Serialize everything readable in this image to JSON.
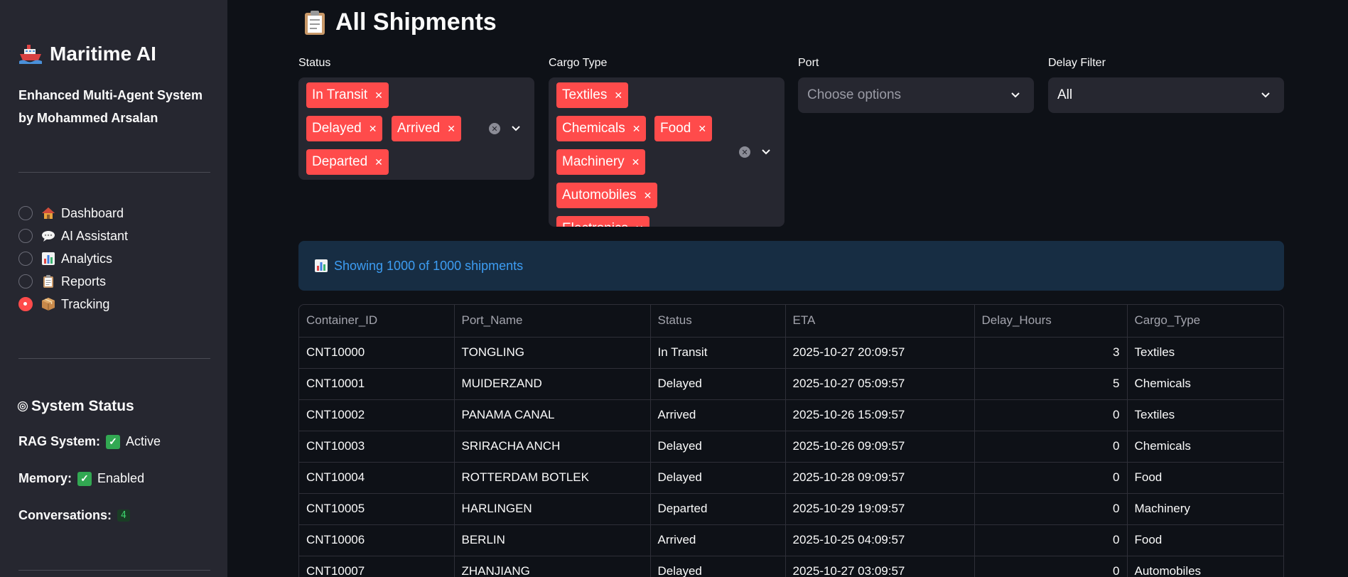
{
  "sidebar": {
    "title": "Maritime AI",
    "subtitle": "Enhanced Multi-Agent System by Mohammed Arsalan",
    "nav": [
      {
        "label": "Dashboard",
        "icon": "house-icon",
        "selected": false
      },
      {
        "label": "AI Assistant",
        "icon": "speech-bubble-icon",
        "selected": false
      },
      {
        "label": "Analytics",
        "icon": "bar-chart-icon",
        "selected": false
      },
      {
        "label": "Reports",
        "icon": "clipboard-icon",
        "selected": false
      },
      {
        "label": "Tracking",
        "icon": "package-icon",
        "selected": true
      }
    ],
    "system_status": {
      "title": "System Status",
      "rag_label": "RAG System:",
      "rag_value": "Active",
      "memory_label": "Memory:",
      "memory_value": "Enabled",
      "conversations_label": "Conversations:",
      "conversations_value": "4"
    }
  },
  "main": {
    "title": "All Shipments",
    "filters": {
      "status": {
        "label": "Status",
        "selected": [
          "In Transit",
          "Delayed",
          "Arrived",
          "Departed"
        ]
      },
      "cargo_type": {
        "label": "Cargo Type",
        "selected": [
          "Textiles",
          "Chemicals",
          "Food",
          "Machinery",
          "Automobiles",
          "Electronics"
        ]
      },
      "port": {
        "label": "Port",
        "placeholder": "Choose options"
      },
      "delay": {
        "label": "Delay Filter",
        "value": "All"
      }
    },
    "info": "Showing 1000 of 1000 shipments",
    "table": {
      "columns": [
        "Container_ID",
        "Port_Name",
        "Status",
        "ETA",
        "Delay_Hours",
        "Cargo_Type"
      ],
      "rows": [
        [
          "CNT10000",
          "TONGLING",
          "In Transit",
          "2025-10-27 20:09:57",
          "3",
          "Textiles"
        ],
        [
          "CNT10001",
          "MUIDERZAND",
          "Delayed",
          "2025-10-27 05:09:57",
          "5",
          "Chemicals"
        ],
        [
          "CNT10002",
          "PANAMA CANAL",
          "Arrived",
          "2025-10-26 15:09:57",
          "0",
          "Textiles"
        ],
        [
          "CNT10003",
          "SRIRACHA ANCH",
          "Delayed",
          "2025-10-26 09:09:57",
          "0",
          "Chemicals"
        ],
        [
          "CNT10004",
          "ROTTERDAM BOTLEK",
          "Delayed",
          "2025-10-28 09:09:57",
          "0",
          "Food"
        ],
        [
          "CNT10005",
          "HARLINGEN",
          "Departed",
          "2025-10-29 19:09:57",
          "0",
          "Machinery"
        ],
        [
          "CNT10006",
          "BERLIN",
          "Arrived",
          "2025-10-25 04:09:57",
          "0",
          "Food"
        ],
        [
          "CNT10007",
          "ZHANJIANG",
          "Delayed",
          "2025-10-27 03:09:57",
          "0",
          "Automobiles"
        ]
      ]
    }
  },
  "colors": {
    "accent": "#ff4b4b",
    "sidebar_bg": "#262730",
    "page_bg": "#0e1117",
    "info_bg": "#172d43",
    "info_text": "#3d9df3"
  }
}
